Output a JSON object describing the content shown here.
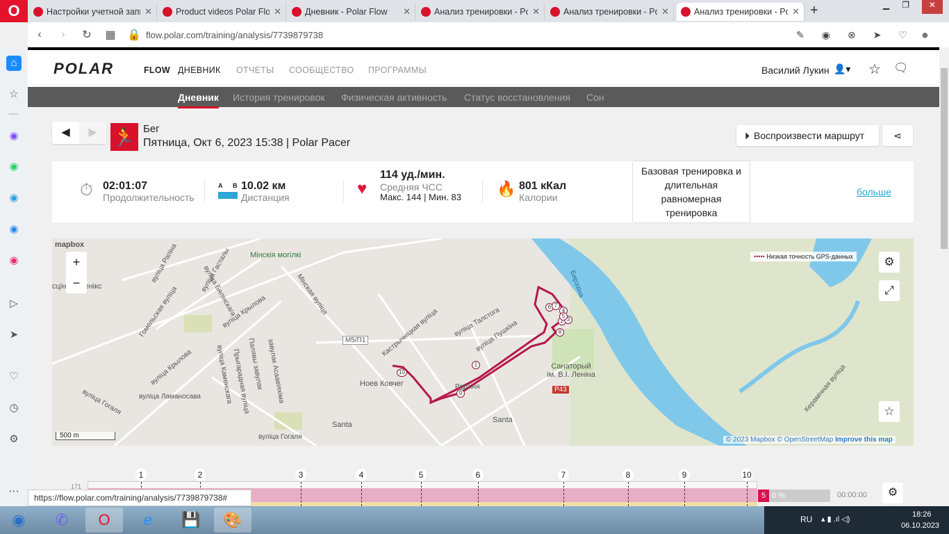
{
  "browser": {
    "tabs": [
      {
        "title": "Настройки учетной записи"
      },
      {
        "title": "Product videos Polar Flow"
      },
      {
        "title": "Дневник - Polar Flow"
      },
      {
        "title": "Анализ тренировки - Polar Flow"
      },
      {
        "title": "Анализ тренировки - Polar Flow"
      },
      {
        "title": "Анализ тренировки - Polar Flow"
      }
    ],
    "url": "flow.polar.com/training/analysis/7739879738",
    "status_url": "https://flow.polar.com/training/analysis/7739879738#"
  },
  "header": {
    "logo": "POLAR",
    "flow": "FLOW",
    "nav": [
      "ДНЕВНИК",
      "ОТЧЕТЫ",
      "СООБЩЕСТВО",
      "ПРОГРАММЫ"
    ],
    "user": "Василий Лукин"
  },
  "subnav": [
    "Дневник",
    "История тренировок",
    "Физическая активность",
    "Статус восстановления",
    "Сон"
  ],
  "training": {
    "sport": "Бег",
    "date": "Пятница, Окт 6, 2023 15:38 | Polar Pacer",
    "replay": "Воспроизвести маршрут"
  },
  "stats": {
    "duration": {
      "value": "02:01:07",
      "label": "Продолжительность"
    },
    "distance": {
      "value": "10.02 км",
      "label": "Дистанция",
      "a": "A",
      "b": "B"
    },
    "hr": {
      "value": "114 уд./мин.",
      "label": "Средняя ЧСС",
      "minmax": "Макс. 144  |  Мин. 83"
    },
    "calories": {
      "value": "801 кКал",
      "label": "Калории"
    },
    "benefit": "Базовая тренировка и длительная равномерная тренировка",
    "more": "больше"
  },
  "map": {
    "brand": "mapbox",
    "legend": "Низкая точность GPS-данных",
    "scale": "500 m",
    "attribution": {
      "copy": "© 2023 Mapbox ©",
      "osm": "OpenStreetMap",
      "improve": "Improve this map"
    },
    "labels": [
      "Мінскія могілкі",
      "вуліца Рапіна",
      "вуліца Гасталы",
      "вуліца Бялінскага",
      "Гомельская вуліца",
      "вуліца Крылова",
      "вуліца Крылова",
      "вуліца Гогаля",
      "вуліца Ламаносава",
      "вуліца Каменскага",
      "Прыгарадная вуліца",
      "Палявы завулак",
      "завулак Асаавіяхіма",
      "Мінская вуліца",
      "Кастрычніцкая вуліца",
      "вуліца Талстога",
      "вуліца Пушкіна",
      "M5/П1",
      "Ноев Ковчег",
      "Santa",
      "Santa",
      "Санаторый ім. В.І. Леніна",
      "P43",
      "Бярэзіна",
      "Керамічная вуліца",
      "вуліца Гогаля",
      "сцініца Фенікс",
      "Радзіня"
    ],
    "markers": [
      "1",
      "2",
      "3",
      "4",
      "5",
      "6",
      "7",
      "8",
      "9",
      "10"
    ]
  },
  "timeline": {
    "y_tick": "171",
    "laps": [
      "1",
      "2",
      "3",
      "4",
      "5",
      "6",
      "7",
      "8",
      "9",
      "10"
    ],
    "zone": "5",
    "zone_pct": "0 %",
    "zone_time": "00:00:00"
  },
  "taskbar": {
    "lang": "RU",
    "time": "18:26",
    "date": "06.10.2023"
  },
  "colors": {
    "brand": "#d8112c",
    "route": "#b5184a"
  }
}
